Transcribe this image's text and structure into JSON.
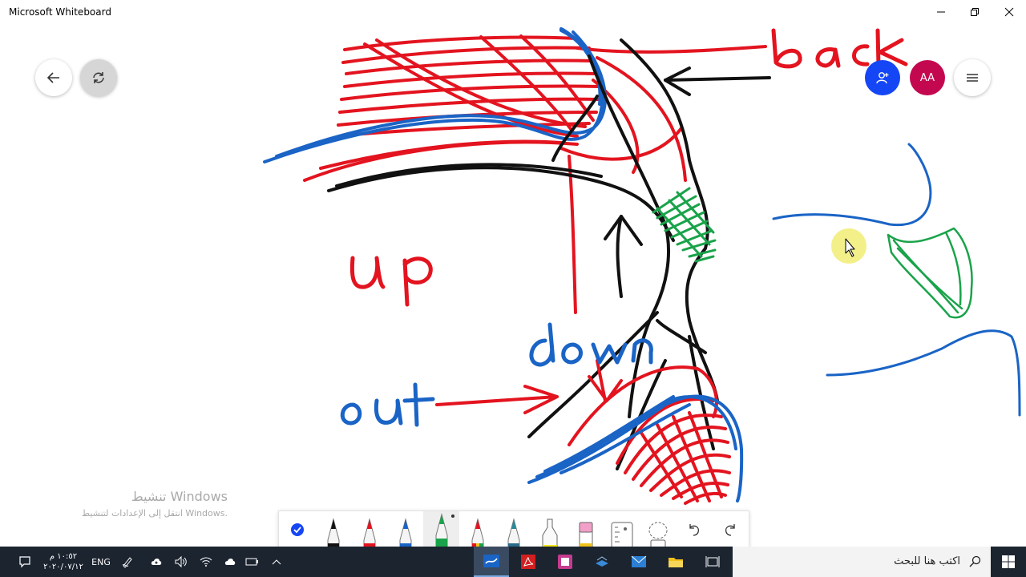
{
  "app": {
    "title": "Microsoft Whiteboard"
  },
  "window": {
    "minimize": "minimize",
    "maximize": "restore",
    "close": "close"
  },
  "canvas_text": {
    "back": "back",
    "up": "up",
    "down": "down",
    "out": "out"
  },
  "top_left": {
    "back_icon": "arrow-left-icon",
    "share_icon": "sync-icon"
  },
  "top_right": {
    "invite_icon": "add-person-icon",
    "avatar_initials": "AA",
    "menu_icon": "hamburger-menu-icon"
  },
  "activation": {
    "title": "تنشيط Windows",
    "subtitle": "انتقل إلى الإعدادات لتنشيط Windows."
  },
  "toolbar": {
    "tools": [
      "select-check",
      "black-pen",
      "red-pen",
      "blue-pen",
      "green-pen",
      "rainbow-pen",
      "galaxy-pen",
      "highlighter",
      "eraser",
      "ruler",
      "lasso",
      "undo",
      "redo"
    ],
    "selected": "green-pen"
  },
  "taskbar": {
    "time": "١٠:٥٢ م",
    "date": "٢٠٢٠/٠٧/١٢",
    "language": "ENG",
    "search_placeholder": "اكتب هنا للبحث"
  },
  "colors": {
    "ink_red": "#e3141f",
    "ink_blue": "#1a64c6",
    "ink_green": "#1aa34a",
    "ink_black": "#111111",
    "avatar_blue": "#1446f5",
    "avatar_red": "#c4084f",
    "taskbar": "#1c2430"
  }
}
